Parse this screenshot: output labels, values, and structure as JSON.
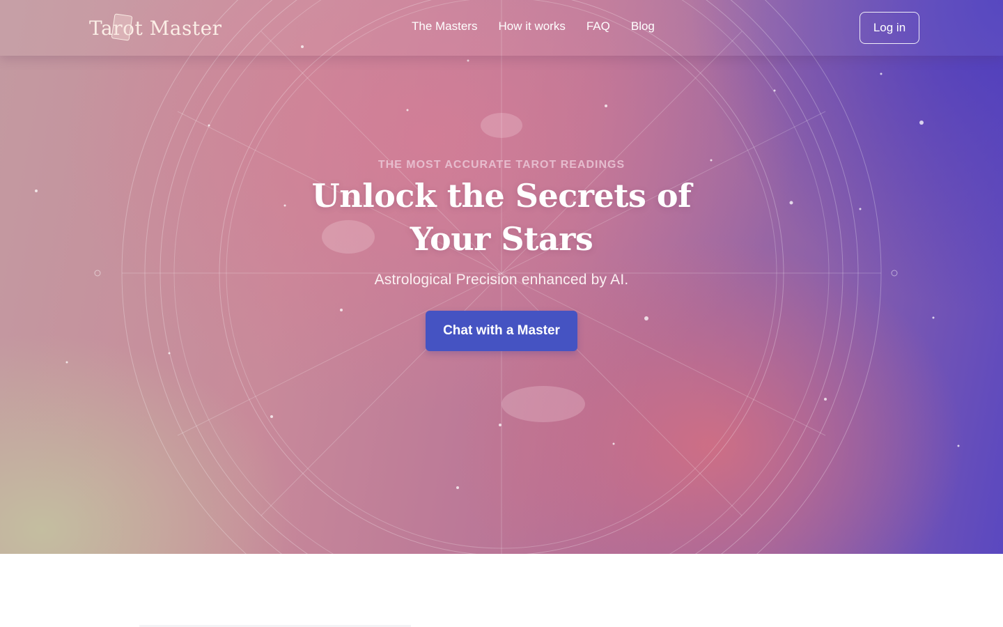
{
  "brand": {
    "logo_text": "Tarot Master",
    "logo_icon": "tarot-card-icon"
  },
  "nav": {
    "links": [
      {
        "label": "The Masters"
      },
      {
        "label": "How it works"
      },
      {
        "label": "FAQ"
      },
      {
        "label": "Blog"
      }
    ],
    "login_label": "Log in"
  },
  "hero": {
    "eyebrow": "THE MOST ACCURATE TAROT READINGS",
    "headline_line1": "Unlock the Secrets of",
    "headline_line2": "Your Stars",
    "subheadline": "Astrological Precision enhanced by AI.",
    "cta_label": "Chat with a Master",
    "background_icon": "astrological-wheel-icon"
  },
  "colors": {
    "cta": "#4553c2",
    "gradient_left": "#c4c0a0",
    "gradient_center": "#c88a9a",
    "gradient_right": "#4b3cbe"
  }
}
